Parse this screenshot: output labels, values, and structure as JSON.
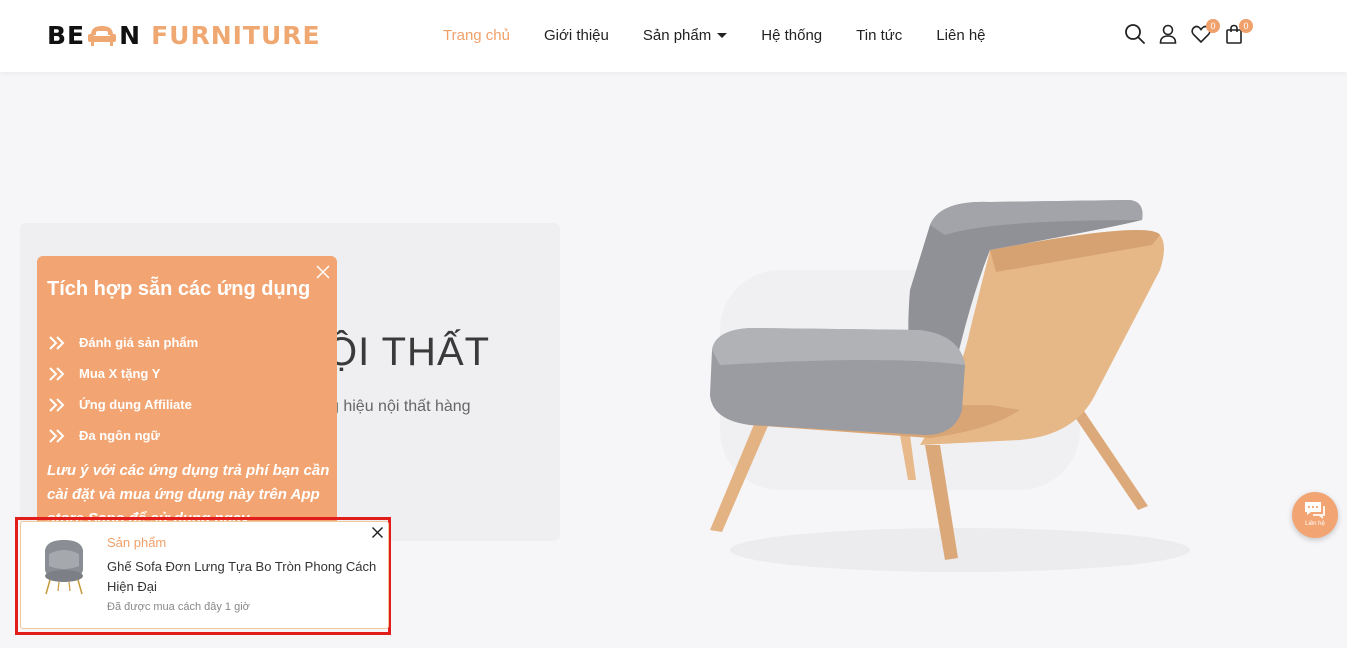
{
  "brand": {
    "logo_text_left": "BE",
    "logo_text_right": "N",
    "logo_text_accent": "FURNITURE",
    "accent_color": "#f0a06a"
  },
  "nav": {
    "items": [
      {
        "label": "Trang chủ",
        "active": true
      },
      {
        "label": "Giới thiệu",
        "active": false
      },
      {
        "label": "Sản phẩm",
        "active": false,
        "has_dropdown": true
      },
      {
        "label": "Hệ thống",
        "active": false
      },
      {
        "label": "Tin tức",
        "active": false
      },
      {
        "label": "Liên hệ",
        "active": false
      }
    ]
  },
  "header_icons": {
    "search": "search-icon",
    "account": "user-icon",
    "wishlist": "heart-icon",
    "cart": "bag-icon",
    "wishlist_count": "0",
    "cart_count": "0"
  },
  "hero": {
    "title_partial": "ỘI THẤT",
    "subtitle_partial": "g hiệu nội thất hàng"
  },
  "promo": {
    "heading": "Tích hợp sẵn các ứng dụng",
    "items": [
      "Đánh giá sản phẩm",
      "Mua X tặng Y",
      "Ứng dụng Affiliate",
      "Đa ngôn ngữ"
    ],
    "note": "Lưu ý với các ứng dụng trả phí bạn cần cài đặt và mua ứng dụng này trên App store Sapo để sử dụng ngay"
  },
  "recent_purchase": {
    "tag": "Sản phẩm",
    "product_name": "Ghế Sofa Đơn Lưng Tựa Bo Tròn Phong Cách Hiện Đại",
    "time_text": "Đã được mua cách đây 1 giờ"
  },
  "contact_fab": {
    "label": "Liên hệ"
  }
}
